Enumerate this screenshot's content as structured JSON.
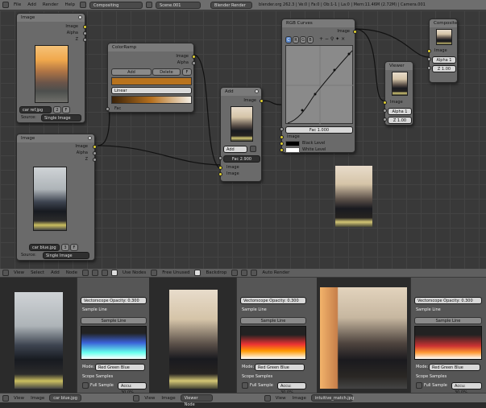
{
  "menu": {
    "items": [
      "File",
      "Add",
      "Render",
      "Help"
    ],
    "editor": "Compositing",
    "scene": "Scene.001",
    "engine": "Blender Render",
    "info": "blender.org 262.3 | Ve:0 | Fa:0 | Ob:1-1 | La:0 | Mem:11.46M (2.72M) | Camera.001"
  },
  "nodes": {
    "image1": {
      "title": "Image",
      "out_image": "Image",
      "out_alpha": "Alpha",
      "out_z": "Z",
      "filename": "car ref.jpg",
      "users": "2",
      "f": "F",
      "source_label": "Source:",
      "source": "Single Image"
    },
    "image2": {
      "title": "Image",
      "out_image": "Image",
      "out_alpha": "Alpha",
      "out_z": "Z",
      "filename": "car blue.jpg",
      "users": "3",
      "f": "F",
      "source_label": "Source:",
      "source": "Single Image"
    },
    "ramp": {
      "title": "ColorRamp",
      "out_image": "Image",
      "out_alpha": "Alpha",
      "add": "Add",
      "delete": "Delete",
      "f": "F",
      "interp": "Linear",
      "fac": "Fac"
    },
    "add": {
      "title": "Add",
      "out_image": "Image",
      "mode": "Add",
      "fac": "Fac 2.900",
      "in_image1": "Image",
      "in_image2": "Image"
    },
    "curves": {
      "title": "RGB Curves",
      "tabs": [
        "C",
        "R",
        "G",
        "B"
      ],
      "out_image": "Image",
      "fac": "Fac 1.000",
      "in_image": "Image",
      "black": "Black Level",
      "white": "White Level"
    },
    "viewer": {
      "title": "Viewer",
      "in_image": "Image",
      "alpha": "Alpha 1",
      "z": "Z 1.00"
    },
    "composite": {
      "title": "Composite",
      "in_image": "Image",
      "alpha": "Alpha 1",
      "z": "Z 1.00"
    }
  },
  "nodebar": {
    "menus": [
      "View",
      "Select",
      "Add",
      "Node"
    ],
    "use_nodes": "Use Nodes",
    "free_unused": "Free Unused",
    "backdrop": "Backdrop",
    "auto_render": "Auto Render"
  },
  "panels": [
    {
      "vec": "Vectorscope Opacity: 0.300",
      "sample_line_hdr": "Sample Line",
      "sample_btn": "Sample Line",
      "mode_label": "Mode:",
      "mode": "Red Green Blue",
      "scope_hdr": "Scope Samples",
      "full": "Full Sample",
      "accu": "Accu: 30.0%"
    },
    {
      "vec": "Vectorscope Opacity: 0.300",
      "sample_line_hdr": "Sample Line",
      "sample_btn": "Sample Line",
      "mode_label": "Mode:",
      "mode": "Red Green Blue",
      "scope_hdr": "Scope Samples",
      "full": "Full Sample",
      "accu": "Accu: 30.0%"
    },
    {
      "vec": "Vectorscope Opacity: 0.300",
      "sample_line_hdr": "Sample Line",
      "sample_btn": "Sample Line",
      "mode_label": "Mode:",
      "mode": "Red Green Blue",
      "scope_hdr": "Scope Samples",
      "full": "Full Sample",
      "accu": "Accu: 30.0%"
    }
  ],
  "status": {
    "s1_menus": [
      "View",
      "Image"
    ],
    "s1_file": "car blue.jpg",
    "s2_menus": [
      "View",
      "Image"
    ],
    "s2_file": "Viewer Node",
    "s3_menus": [
      "View",
      "Image"
    ],
    "s3_file": "intuitive_match.jpg"
  }
}
